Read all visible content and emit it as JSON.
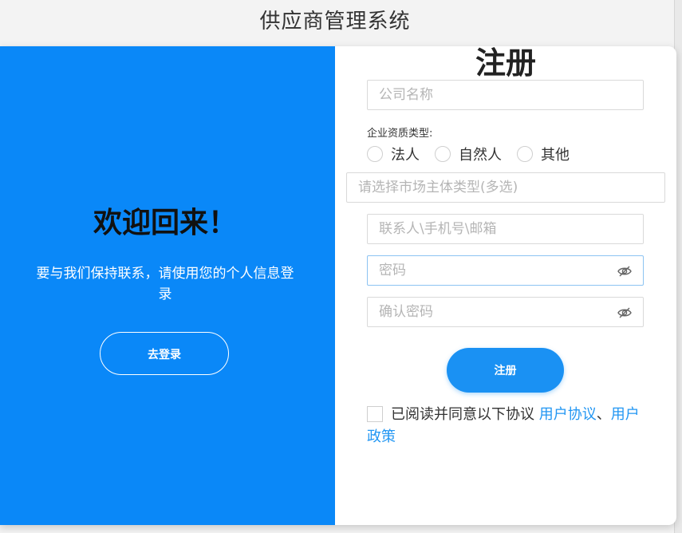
{
  "app_title": "供应商管理系统",
  "left_panel": {
    "heading": "欢迎回来！",
    "description": "要与我们保持联系，请使用您的个人信息登录",
    "login_button": "去登录",
    "background_color": "#0a88f8"
  },
  "register": {
    "heading": "注册",
    "company_name_placeholder": "公司名称",
    "qualification_label": "企业资质类型:",
    "qualification_options": [
      "法人",
      "自然人",
      "其他"
    ],
    "market_type_placeholder": "请选择市场主体类型(多选)",
    "contact_placeholder": "联系人\\手机号\\邮箱",
    "password_placeholder": "密码",
    "confirm_password_placeholder": "确认密码",
    "submit_button": "注册",
    "agreement_text": "已阅读并同意以下协议",
    "user_agreement_link": "用户协议",
    "separator": "、",
    "user_policy_link": "用户政策",
    "accent_color": "#1a91f3"
  }
}
